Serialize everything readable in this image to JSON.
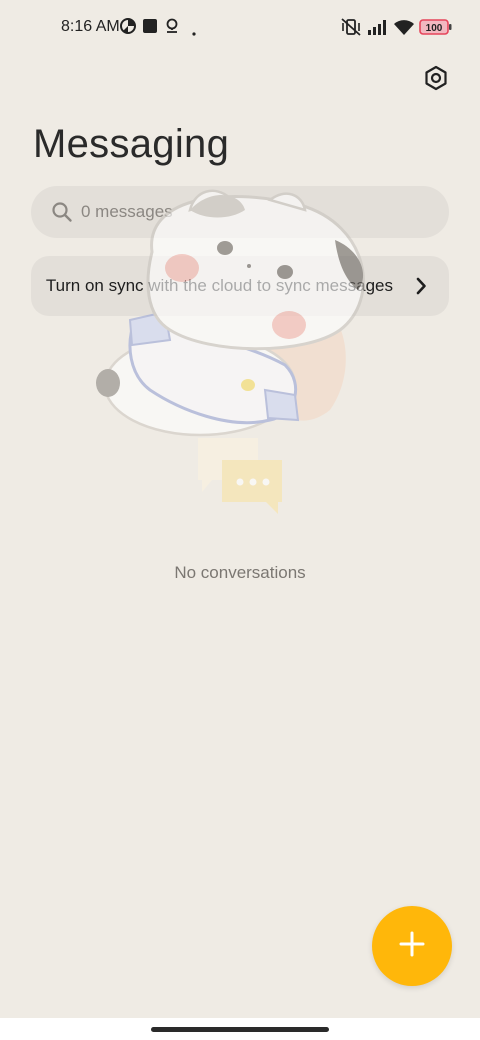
{
  "status_bar": {
    "time": "8:16 AM",
    "battery_level": "100",
    "left_icons": [
      "data-saver-icon",
      "square-notification-icon",
      "location-pin-icon",
      "dot-icon"
    ],
    "right_icons": [
      "mute-vibrate-icon",
      "signal-icon",
      "wifi-icon",
      "battery-icon"
    ]
  },
  "header": {
    "title": "Messaging",
    "settings_icon": "settings-hexagon-icon"
  },
  "search": {
    "placeholder": "0 messages",
    "value": "",
    "icon": "search-icon"
  },
  "sync_banner": {
    "text": "Turn on sync with the cloud to sync messages",
    "icon": "chevron-right-icon"
  },
  "empty_state": {
    "illustration": "sleeping-cat-with-chat-bubbles",
    "text": "No conversations"
  },
  "fab": {
    "icon": "plus-icon"
  },
  "colors": {
    "background": "#efebe4",
    "accent": "#ffb70a",
    "surface": "#e3dfd9"
  }
}
